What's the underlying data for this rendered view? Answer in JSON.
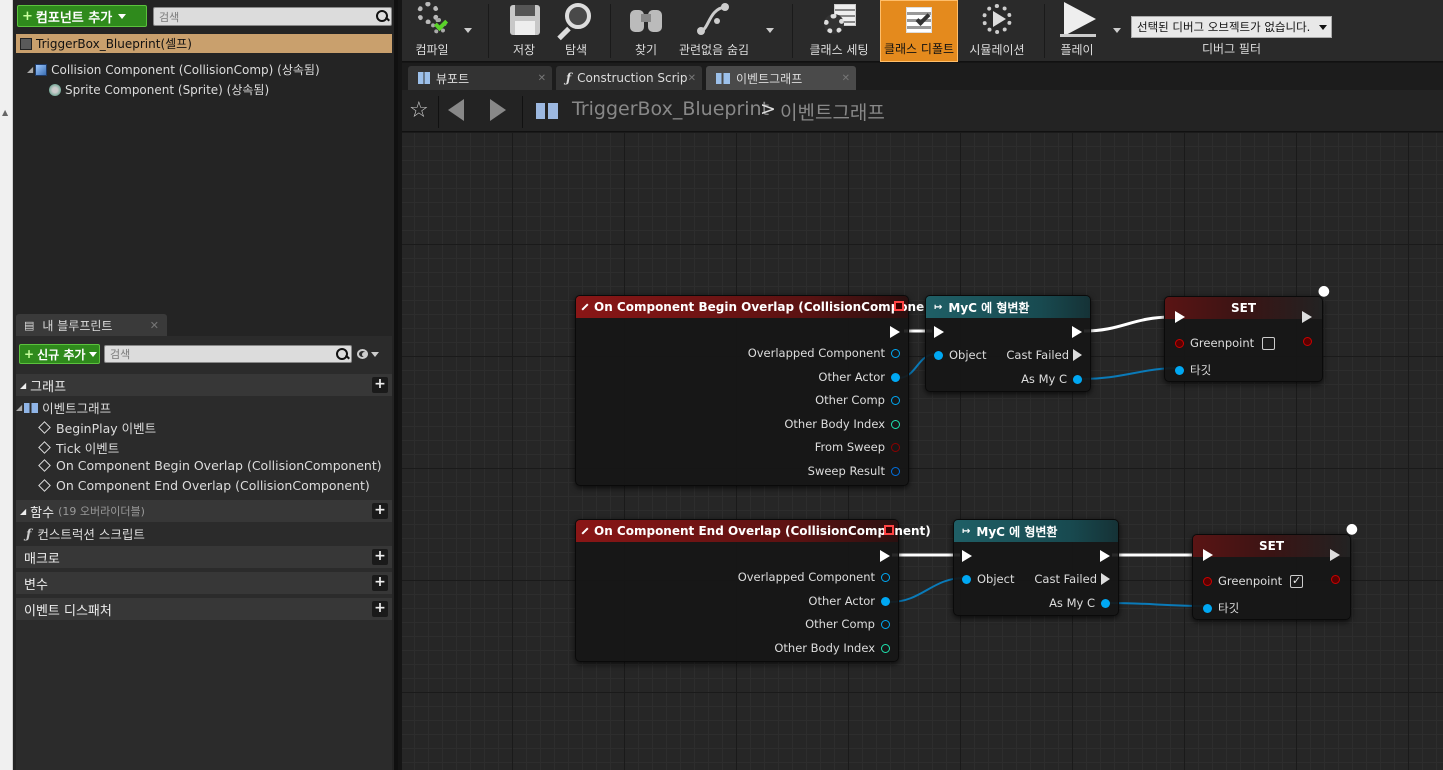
{
  "components": {
    "add_button": "컴포넌트 추가",
    "search_placeholder": "검색",
    "root": "TriggerBox_Blueprint(셀프)",
    "children": [
      "Collision Component (CollisionComp) (상속됨)",
      "Sprite Component (Sprite) (상속됨)"
    ]
  },
  "myblueprint": {
    "tab": "내 블루프린트",
    "add_button": "신규 추가",
    "search_placeholder": "검색",
    "graph_cat": "그래프",
    "event_graph": "이벤트그래프",
    "events": [
      "BeginPlay 이벤트",
      "Tick 이벤트",
      "On Component Begin Overlap (CollisionComponent)",
      "On Component End Overlap (CollisionComponent)"
    ],
    "functions_cat": "함수",
    "functions_sub": "(19 오버라이더블)",
    "construction": "컨스트럭션 스크립트",
    "macros_cat": "매크로",
    "vars_cat": "변수",
    "dispatchers_cat": "이벤트 디스패처"
  },
  "toolbar": {
    "compile": "컴파일",
    "save": "저장",
    "browse": "탐색",
    "find": "찾기",
    "hide_unrelated": "관련없음 숨김",
    "class_settings": "클래스 세팅",
    "class_defaults": "클래스 디폴트",
    "simulation": "시뮬레이션",
    "play": "플레이",
    "debug_select": "선택된 디버그 오브젝트가 없습니다.",
    "debug_filter": "디버그 필터"
  },
  "tabs": [
    "뷰포트",
    "Construction Scrip",
    "이벤트그래프"
  ],
  "breadcrumb": {
    "blueprint": "TriggerBox_Blueprint",
    "sep": ">",
    "graph": "이벤트그래프"
  },
  "nodes": {
    "begin": {
      "title": "On Component Begin Overlap (CollisionComponent)",
      "pins": [
        "Overlapped Component",
        "Other Actor",
        "Other Comp",
        "Other Body Index",
        "From Sweep",
        "Sweep Result"
      ]
    },
    "cast1": {
      "title": "MyC 에 형변환",
      "object": "Object",
      "failed": "Cast Failed",
      "as": "As My C"
    },
    "set1": {
      "title": "SET",
      "var": "Greenpoint",
      "target": "타깃",
      "checked": false
    },
    "end": {
      "title": "On Component End Overlap (CollisionComponent)",
      "pins": [
        "Overlapped Component",
        "Other Actor",
        "Other Comp",
        "Other Body Index"
      ]
    },
    "cast2": {
      "title": "MyC 에 형변환",
      "object": "Object",
      "failed": "Cast Failed",
      "as": "As My C"
    },
    "set2": {
      "title": "SET",
      "var": "Greenpoint",
      "target": "타깃",
      "checked": true
    }
  },
  "colors": {
    "accent": "#e48a1d",
    "object_pin": "#00a8f3",
    "int_pin": "#1fe3af",
    "bool_pin": "#8c0000",
    "green": "#2f8a1c"
  }
}
